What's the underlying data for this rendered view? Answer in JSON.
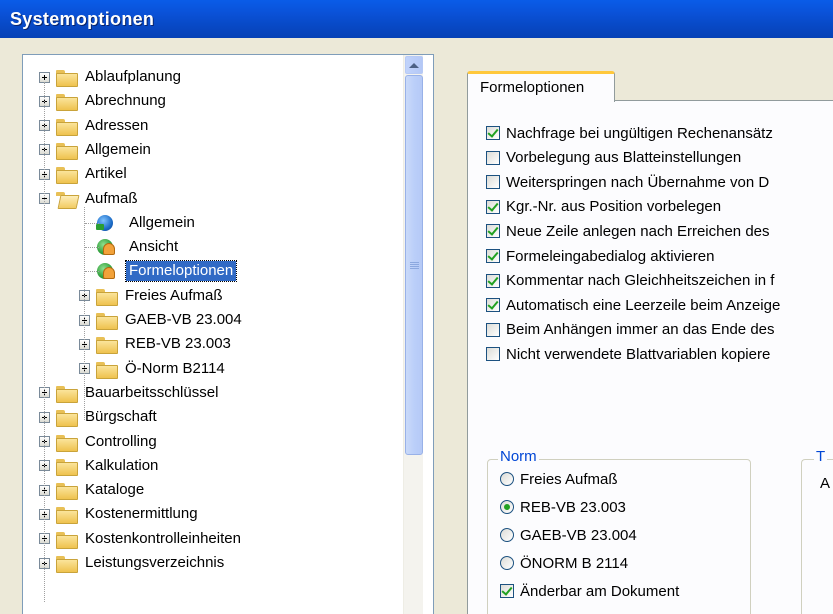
{
  "window": {
    "title": "Systemoptionen"
  },
  "tree": {
    "items": [
      {
        "label": "Ablaufplanung",
        "level": 0,
        "expander": "plus",
        "icon": "folder-icon"
      },
      {
        "label": "Abrechnung",
        "level": 0,
        "expander": "plus",
        "icon": "folder-icon"
      },
      {
        "label": "Adressen",
        "level": 0,
        "expander": "plus",
        "icon": "folder-icon"
      },
      {
        "label": "Allgemein",
        "level": 0,
        "expander": "plus",
        "icon": "folder-icon"
      },
      {
        "label": "Artikel",
        "level": 0,
        "expander": "plus",
        "icon": "folder-icon"
      },
      {
        "label": "Aufmaß",
        "level": 0,
        "expander": "minus",
        "icon": "open-folder-icon"
      },
      {
        "label": "Allgemein",
        "level": 1,
        "expander": "none",
        "icon": "globe-icon"
      },
      {
        "label": "Ansicht",
        "level": 1,
        "expander": "none",
        "icon": "user-settings-icon"
      },
      {
        "label": "Formeloptionen",
        "level": 1,
        "expander": "none",
        "icon": "user-settings-icon",
        "selected": true
      },
      {
        "label": "Freies Aufmaß",
        "level": 1,
        "expander": "plus",
        "icon": "folder-icon"
      },
      {
        "label": "GAEB-VB 23.004",
        "level": 1,
        "expander": "plus",
        "icon": "folder-icon"
      },
      {
        "label": "REB-VB 23.003",
        "level": 1,
        "expander": "plus",
        "icon": "folder-icon"
      },
      {
        "label": "Ö-Norm B2114",
        "level": 1,
        "expander": "plus",
        "icon": "folder-icon"
      },
      {
        "label": "Bauarbeitsschlüssel",
        "level": 0,
        "expander": "plus",
        "icon": "folder-icon"
      },
      {
        "label": "Bürgschaft",
        "level": 0,
        "expander": "plus",
        "icon": "folder-icon"
      },
      {
        "label": "Controlling",
        "level": 0,
        "expander": "plus",
        "icon": "folder-icon"
      },
      {
        "label": "Kalkulation",
        "level": 0,
        "expander": "plus",
        "icon": "folder-icon"
      },
      {
        "label": "Kataloge",
        "level": 0,
        "expander": "plus",
        "icon": "folder-icon"
      },
      {
        "label": "Kostenermittlung",
        "level": 0,
        "expander": "plus",
        "icon": "folder-icon"
      },
      {
        "label": "Kostenkontrolleinheiten",
        "level": 0,
        "expander": "plus",
        "icon": "folder-icon"
      },
      {
        "label": "Leistungsverzeichnis",
        "level": 0,
        "expander": "plus",
        "icon": "folder-icon"
      }
    ]
  },
  "tab": {
    "label": "Formeloptionen"
  },
  "options": [
    {
      "label": "Nachfrage bei ungültigen Rechenansätz",
      "checked": true
    },
    {
      "label": "Vorbelegung aus Blatteinstellungen",
      "checked": false
    },
    {
      "label": "Weiterspringen nach Übernahme von D",
      "checked": false
    },
    {
      "label": "Kgr.-Nr. aus Position vorbelegen",
      "checked": true
    },
    {
      "label": "Neue Zeile anlegen nach Erreichen des",
      "checked": true
    },
    {
      "label": "Formeleingabedialog aktivieren",
      "checked": true
    },
    {
      "label": "Kommentar nach Gleichheitszeichen in f",
      "checked": true
    },
    {
      "label": "Automatisch eine Leerzeile beim Anzeige",
      "checked": true
    },
    {
      "label": "Beim Anhängen immer an das Ende des",
      "checked": false
    },
    {
      "label": "Nicht verwendete Blattvariablen kopiere",
      "checked": false
    }
  ],
  "norm_group": {
    "legend": "Norm",
    "radios": [
      {
        "label": "Freies Aufmaß",
        "selected": false
      },
      {
        "label": "REB-VB 23.003",
        "selected": true
      },
      {
        "label": "GAEB-VB 23.004",
        "selected": false
      },
      {
        "label": "ÖNORM B 2114",
        "selected": false
      }
    ],
    "editable_label": "Änderbar am Dokument",
    "editable_checked": true
  },
  "t_group": {
    "legend": "T",
    "text": "A"
  }
}
